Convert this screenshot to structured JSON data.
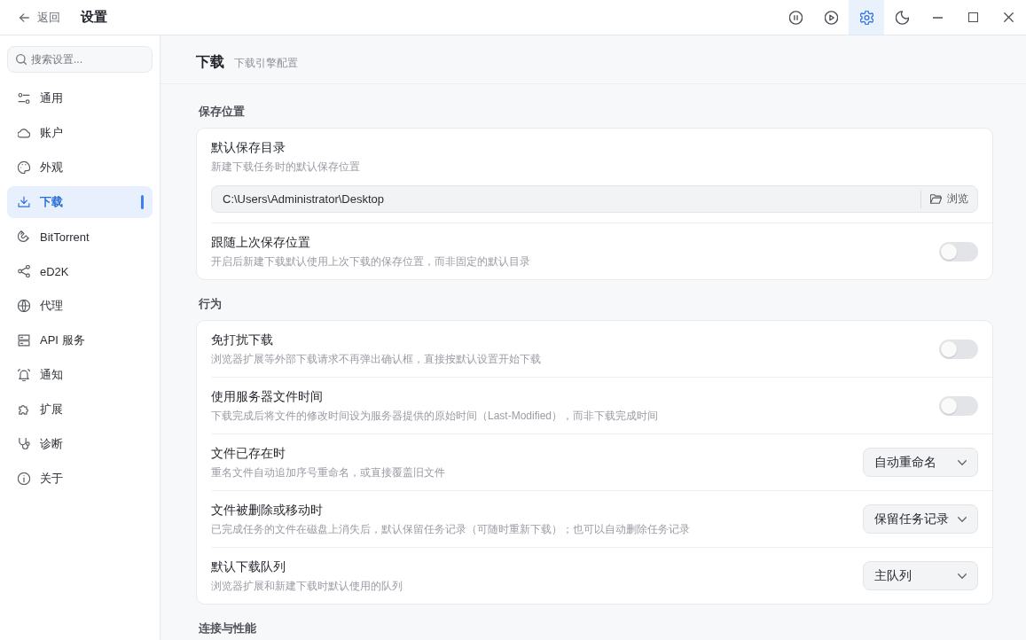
{
  "titlebar": {
    "back_label": "返回",
    "title": "设置",
    "toolbar": [
      {
        "kind": "pause",
        "selected": false
      },
      {
        "kind": "play",
        "selected": false
      },
      {
        "kind": "settings",
        "selected": true
      },
      {
        "kind": "theme",
        "selected": false
      }
    ]
  },
  "sidebar": {
    "search": {
      "placeholder": "搜索设置..."
    },
    "items": [
      {
        "label": "通用",
        "selected": false
      },
      {
        "label": "账户",
        "selected": false
      },
      {
        "label": "外观",
        "selected": false
      },
      {
        "label": "下载",
        "selected": true
      },
      {
        "label": "BitTorrent",
        "selected": false
      },
      {
        "label": "eD2K",
        "selected": false
      },
      {
        "label": "代理",
        "selected": false
      },
      {
        "label": "API 服务",
        "selected": false
      },
      {
        "label": "通知",
        "selected": false
      },
      {
        "label": "扩展",
        "selected": false
      },
      {
        "label": "诊断",
        "selected": false
      },
      {
        "label": "关于",
        "selected": false
      }
    ]
  },
  "page": {
    "title": "下载",
    "subtitle": "下载引擎配置"
  },
  "sections": [
    {
      "title": "保存位置",
      "rows": [
        {
          "kind": "path",
          "title": "默认保存目录",
          "description": "新建下载任务时的默认保存位置",
          "value": "C:\\Users\\Administrator\\Desktop",
          "button": "浏览"
        },
        {
          "kind": "toggle",
          "title": "跟随上次保存位置",
          "description": "开启后新建下载默认使用上次下载的保存位置，而非固定的默认目录",
          "on": false
        }
      ]
    },
    {
      "title": "行为",
      "rows": [
        {
          "kind": "toggle",
          "title": "免打扰下载",
          "description": "浏览器扩展等外部下载请求不再弹出确认框，直接按默认设置开始下载",
          "on": false
        },
        {
          "kind": "toggle",
          "title": "使用服务器文件时间",
          "description": "下载完成后将文件的修改时间设为服务器提供的原始时间（Last-Modified），而非下载完成时间",
          "on": false
        },
        {
          "kind": "select",
          "title": "文件已存在时",
          "description": "重名文件自动追加序号重命名，或直接覆盖旧文件",
          "value": "自动重命名"
        },
        {
          "kind": "select",
          "title": "文件被删除或移动时",
          "description": "已完成任务的文件在磁盘上消失后，默认保留任务记录（可随时重新下载）；也可以自动删除任务记录",
          "value": "保留任务记录"
        },
        {
          "kind": "select",
          "title": "默认下载队列",
          "description": "浏览器扩展和新建下载时默认使用的队列",
          "value": "主队列"
        }
      ]
    },
    {
      "title": "连接与性能"
    }
  ]
}
